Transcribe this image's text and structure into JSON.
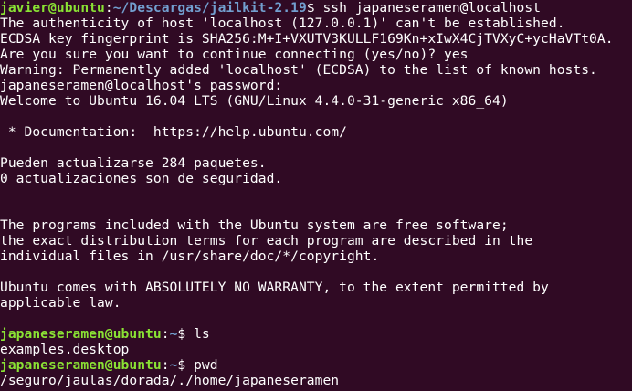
{
  "theme": {
    "background": "#300a24",
    "text": "#ffffff",
    "prompt_user": "#8ae234",
    "prompt_path": "#729fcf"
  },
  "lines": [
    {
      "user": "javier@ubuntu",
      "sep": ":",
      "path": "~/Descargas/jailkit-2.19",
      "rest": "$ ssh japaneseramen@localhost"
    },
    {
      "text": "The authenticity of host 'localhost (127.0.0.1)' can't be established."
    },
    {
      "text": "ECDSA key fingerprint is SHA256:M+I+VXUTV3KULLF169Kn+xIwX4CjTVXyC+ycHaVTt0A."
    },
    {
      "text": "Are you sure you want to continue connecting (yes/no)? yes"
    },
    {
      "text": "Warning: Permanently added 'localhost' (ECDSA) to the list of known hosts."
    },
    {
      "text": "japaneseramen@localhost's password:"
    },
    {
      "text": "Welcome to Ubuntu 16.04 LTS (GNU/Linux 4.4.0-31-generic x86_64)"
    },
    {
      "text": ""
    },
    {
      "text": " * Documentation:  https://help.ubuntu.com/"
    },
    {
      "text": ""
    },
    {
      "text": "Pueden actualizarse 284 paquetes."
    },
    {
      "text": "0 actualizaciones son de seguridad."
    },
    {
      "text": ""
    },
    {
      "text": ""
    },
    {
      "text": "The programs included with the Ubuntu system are free software;"
    },
    {
      "text": "the exact distribution terms for each program are described in the"
    },
    {
      "text": "individual files in /usr/share/doc/*/copyright."
    },
    {
      "text": ""
    },
    {
      "text": "Ubuntu comes with ABSOLUTELY NO WARRANTY, to the extent permitted by"
    },
    {
      "text": "applicable law."
    },
    {
      "text": ""
    },
    {
      "user": "japaneseramen@ubuntu",
      "sep": ":",
      "path": "~",
      "rest": "$ ls"
    },
    {
      "text": "examples.desktop"
    },
    {
      "user": "japaneseramen@ubuntu",
      "sep": ":",
      "path": "~",
      "rest": "$ pwd"
    },
    {
      "text": "/seguro/jaulas/dorada/./home/japaneseramen"
    }
  ]
}
